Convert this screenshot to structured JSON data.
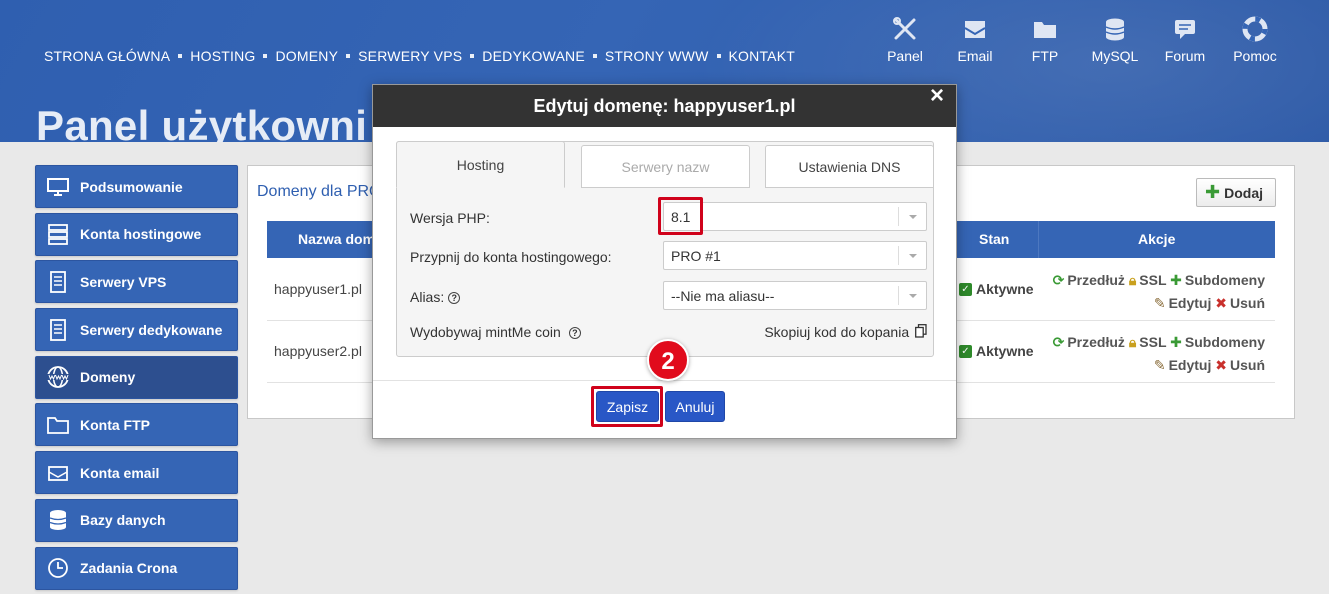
{
  "nav": {
    "items": [
      "STRONA GŁÓWNA",
      "HOSTING",
      "DOMENY",
      "SERWERY VPS",
      "DEDYKOWANE",
      "STRONY WWW",
      "KONTAKT"
    ]
  },
  "quicklinks": [
    {
      "label": "Panel",
      "icon": "tools-icon"
    },
    {
      "label": "Email",
      "icon": "envelope-icon"
    },
    {
      "label": "FTP",
      "icon": "folder-icon"
    },
    {
      "label": "MySQL",
      "icon": "database-icon"
    },
    {
      "label": "Forum",
      "icon": "chat-icon"
    },
    {
      "label": "Pomoc",
      "icon": "lifebuoy-icon"
    }
  ],
  "page_title": "Panel użytkowni",
  "sidebar": {
    "items": [
      {
        "label": "Podsumowanie",
        "icon": "monitor-icon"
      },
      {
        "label": "Konta hostingowe",
        "icon": "server-stack-icon"
      },
      {
        "label": "Serwery VPS",
        "icon": "server-icon"
      },
      {
        "label": "Serwery dedykowane",
        "icon": "server-icon"
      },
      {
        "label": "Domeny",
        "icon": "globe-www-icon"
      },
      {
        "label": "Konta FTP",
        "icon": "folder-icon"
      },
      {
        "label": "Konta email",
        "icon": "envelope-icon"
      },
      {
        "label": "Bazy danych",
        "icon": "database-icon"
      },
      {
        "label": "Zadania Crona",
        "icon": "clock-icon"
      }
    ],
    "active": "Domeny"
  },
  "main": {
    "title": "Domeny dla PRO",
    "add_label": "Dodaj",
    "columns": {
      "name": "Nazwa dom",
      "status": "Stan",
      "actions": "Akcje"
    },
    "rows": [
      {
        "domain": "happyuser1.pl",
        "status": "Aktywne"
      },
      {
        "domain": "happyuser2.pl",
        "status": "Aktywne"
      }
    ],
    "actions": {
      "extend": "Przedłuż",
      "ssl": "SSL",
      "subdomains": "Subdomeny",
      "edit": "Edytuj",
      "delete": "Usuń"
    }
  },
  "dialog": {
    "title": "Edytuj domenę: happyuser1.pl",
    "close": "×",
    "tabs": [
      "Hosting",
      "Serwery nazw",
      "Ustawienia DNS"
    ],
    "fields": {
      "php_label": "Wersja PHP:",
      "php_value": "8.1",
      "hosting_label": "Przypnij do konta hostingowego:",
      "hosting_value": "PRO #1",
      "alias_label": "Alias:",
      "alias_value": "--Nie ma aliasu--",
      "mint_label": "Wydobywaj mintMe coin",
      "copy_label": "Skopiuj kod do kopania"
    },
    "save_label": "Zapisz",
    "cancel_label": "Anuluj"
  },
  "step_badge": "2",
  "colors": {
    "brand_blue": "#3565b5",
    "button_blue": "#2957c6",
    "highlight_red": "#d0021b",
    "header_dark": "#333333"
  }
}
